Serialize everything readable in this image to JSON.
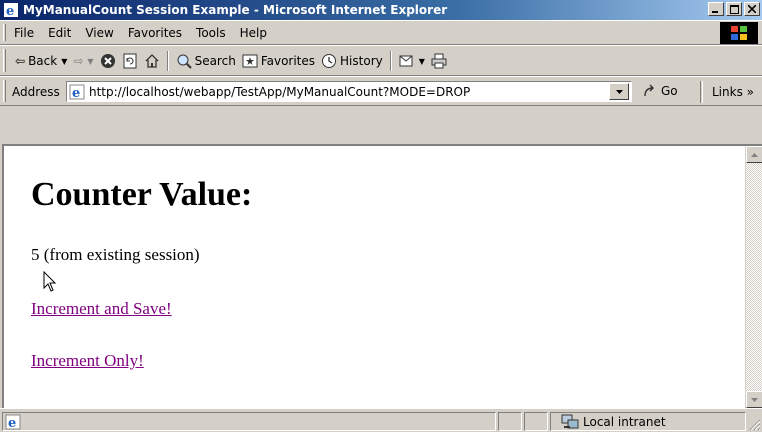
{
  "window": {
    "title": "MyManualCount Session Example - Microsoft Internet Explorer"
  },
  "menu": {
    "items": [
      "File",
      "Edit",
      "View",
      "Favorites",
      "Tools",
      "Help"
    ]
  },
  "toolbar": {
    "back_label": "Back",
    "search_label": "Search",
    "favorites_label": "Favorites",
    "history_label": "History"
  },
  "address": {
    "label": "Address",
    "url": "http://localhost/webapp/TestApp/MyManualCount?MODE=DROP",
    "go_label": "Go",
    "links_label": "Links »"
  },
  "page": {
    "heading": "Counter Value:",
    "counter_text": "5 (from existing session)",
    "links": [
      "Increment and Save!",
      "Increment Only!"
    ]
  },
  "status": {
    "zone": "Local intranet"
  },
  "colors": {
    "visited_link": "#800080",
    "chrome": "#d4d0c8",
    "titlebar_start": "#0a246a"
  }
}
